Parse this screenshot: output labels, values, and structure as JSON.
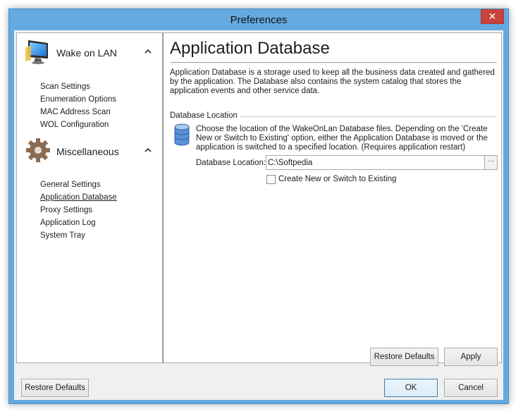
{
  "window": {
    "title": "Preferences",
    "close_glyph": "✕",
    "close_icon": "close-icon"
  },
  "sidebar": {
    "groups": [
      {
        "title": "Wake on LAN",
        "icon": "monitor-icon",
        "items": [
          "Scan Settings",
          "Enumeration Options",
          "MAC Address Scan",
          "WOL Configuration"
        ]
      },
      {
        "title": "Miscellaneous",
        "icon": "gear-icon",
        "items": [
          "General Settings",
          "Application Database",
          "Proxy Settings",
          "Application Log",
          "System Tray"
        ]
      }
    ],
    "active_item": "Application Database"
  },
  "content": {
    "title": "Application Database",
    "description": "Application Database is a storage used to keep all the business data created and gathered by the application. The Database also contains the system catalog that stores the application events and other service data.",
    "section": {
      "label": "Database Location",
      "icon": "database-icon",
      "description": "Choose the location of the WakeOnLan Database files. Depending on the 'Create New or Switch to Existing' option, either the Application Database is moved or the application is switched to a specified location. (Requires application restart)",
      "field_label": "Database Location:",
      "field_value": "C:\\Softpedia",
      "browse_label": "···",
      "checkbox_label": "Create New or Switch to Existing",
      "checkbox_checked": false
    },
    "restore_defaults": "Restore Defaults",
    "apply": "Apply"
  },
  "footer": {
    "restore_defaults": "Restore Defaults",
    "ok": "OK",
    "cancel": "Cancel"
  },
  "colors": {
    "frame": "#64a9e0",
    "close": "#c7433b",
    "default_button_border": "#3c7fb1"
  }
}
